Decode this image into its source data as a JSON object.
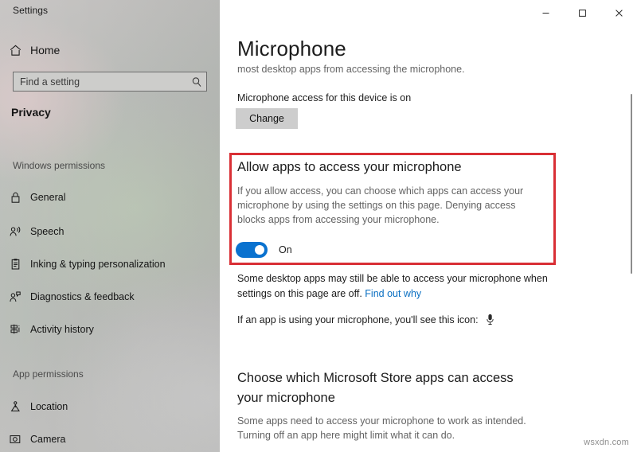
{
  "window": {
    "app_title": "Settings",
    "controls": [
      {
        "name": "minimize",
        "glyph": "─"
      },
      {
        "name": "maximize",
        "glyph": "□"
      },
      {
        "name": "close",
        "glyph": "✕"
      }
    ]
  },
  "sidebar": {
    "home_label": "Home",
    "home_icon": "home-icon",
    "search": {
      "placeholder": "Find a setting",
      "value": "",
      "icon": "search-icon"
    },
    "category": "Privacy",
    "groups": [
      {
        "header": "Windows permissions",
        "items": [
          {
            "label": "General",
            "icon": "lock-icon"
          },
          {
            "label": "Speech",
            "icon": "speech-person-icon"
          },
          {
            "label": "Inking & typing personalization",
            "icon": "clipboard-pen-icon"
          },
          {
            "label": "Diagnostics & feedback",
            "icon": "person-feedback-icon"
          },
          {
            "label": "Activity history",
            "icon": "activity-history-icon"
          }
        ]
      },
      {
        "header": "App permissions",
        "items": [
          {
            "label": "Location",
            "icon": "location-pin-icon"
          },
          {
            "label": "Camera",
            "icon": "camera-icon"
          }
        ]
      }
    ]
  },
  "main": {
    "title": "Microphone",
    "subtitle": "most desktop apps from accessing the microphone.",
    "device_access_status": "Microphone access for this device is on",
    "change_button": "Change",
    "allow_section": {
      "heading": "Allow apps to access your microphone",
      "description": "If you allow access, you can choose which apps can access your microphone by using the settings on this page. Denying access blocks apps from accessing your microphone.",
      "toggle_state": "On",
      "toggle_on": true
    },
    "desktop_note": {
      "text": "Some desktop apps may still be able to access your microphone when settings on this page are off. ",
      "link_text": "Find out why"
    },
    "using_note": {
      "text": "If an app is using your microphone, you'll see this icon:",
      "icon": "microphone-icon"
    },
    "store_section": {
      "heading": "Choose which Microsoft Store apps can access your microphone",
      "description": "Some apps need to access your microphone to work as intended. Turning off an app here might limit what it can do."
    }
  },
  "highlight": {
    "color": "#d92f35"
  },
  "accent_color": "#0a72cf",
  "link_color": "#0a6fc2",
  "watermark": "wsxdn.com"
}
